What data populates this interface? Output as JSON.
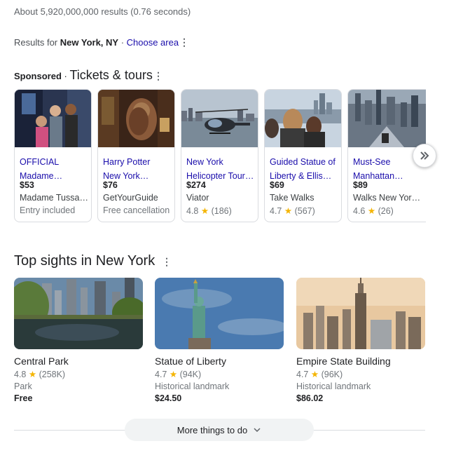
{
  "results_stats": "About 5,920,000,000 results (0.76 seconds)",
  "location": {
    "prefix": "Results for ",
    "place": "New York, NY",
    "separator": " · ",
    "choose_area": "Choose area"
  },
  "sponsored": {
    "label": "Sponsored",
    "separator": " · ",
    "title": "Tickets & tours",
    "cards": [
      {
        "title1": "OFFICIAL",
        "title2": "Madame…",
        "price": "$53",
        "seller": "Madame Tussa…",
        "meta": "Entry included"
      },
      {
        "title1": "Harry Potter",
        "title2": "New York…",
        "price": "$76",
        "seller": "GetYourGuide",
        "meta": "Free cancellation"
      },
      {
        "title1": "New York",
        "title2": "Helicopter Tour…",
        "price": "$274",
        "seller": "Viator",
        "rating": "4.8",
        "reviews": "(186)"
      },
      {
        "title1": "Guided Statue of",
        "title2": "Liberty & Ellis…",
        "price": "$69",
        "seller": "Take Walks",
        "rating": "4.7",
        "reviews": "(567)"
      },
      {
        "title1": "Must-See",
        "title2": "Manhattan…",
        "price": "$89",
        "seller": "Walks New Yor…",
        "rating": "4.6",
        "reviews": "(26)"
      }
    ]
  },
  "top_sights": {
    "title": "Top sights in New York",
    "cards": [
      {
        "name": "Central Park",
        "rating": "4.8",
        "reviews": "(258K)",
        "type": "Park",
        "price": "Free"
      },
      {
        "name": "Statue of Liberty",
        "rating": "4.7",
        "reviews": "(94K)",
        "type": "Historical landmark",
        "price": "$24.50"
      },
      {
        "name": "Empire State Building",
        "rating": "4.7",
        "reviews": "(96K)",
        "type": "Historical landmark",
        "price": "$86.02"
      }
    ]
  },
  "more_button": "More things to do",
  "icons": {
    "star": "★",
    "kebab": "⋮"
  },
  "colors": {
    "link": "#1a0dab",
    "star": "#f4b400",
    "muted": "#70757a"
  }
}
